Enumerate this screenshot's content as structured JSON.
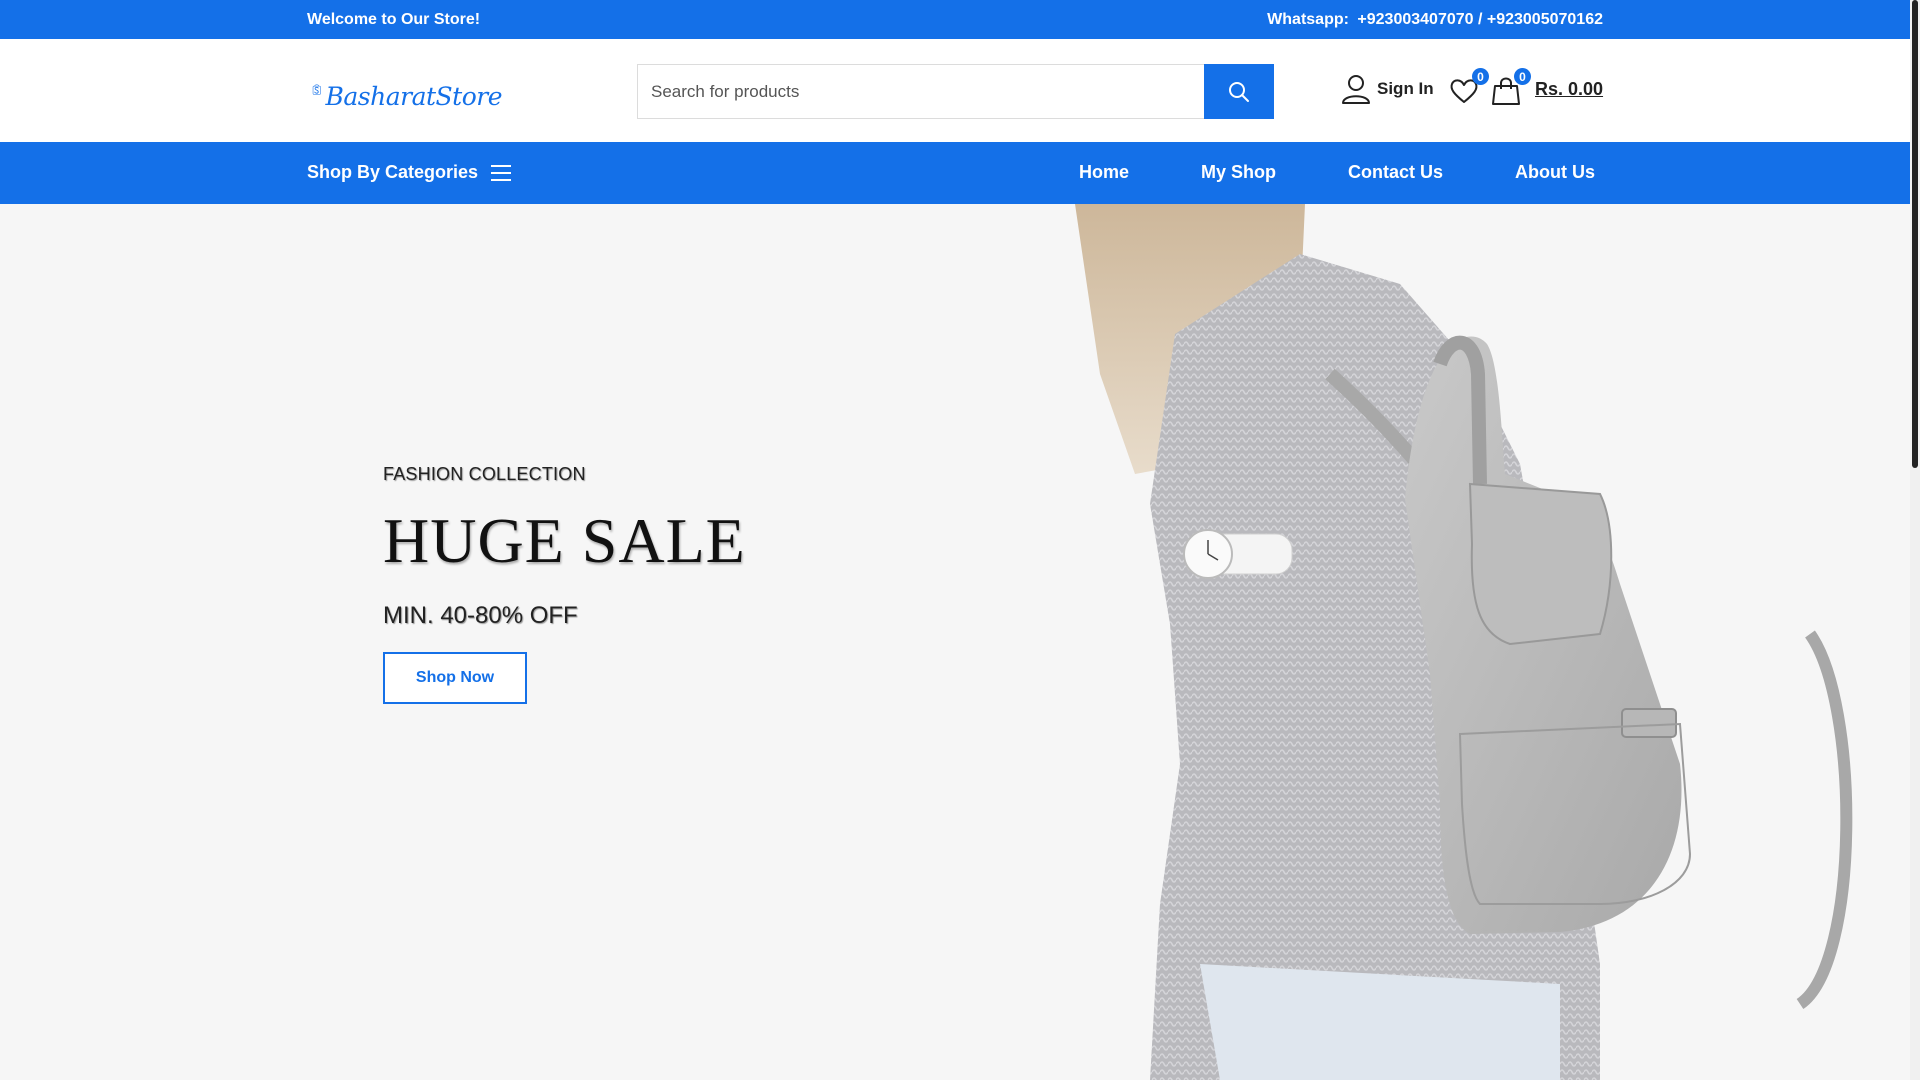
{
  "topbar": {
    "welcome": "Welcome to Our Store!",
    "whatsapp_label": "Whatsapp:",
    "phones": "+923003407070 /  +923005070162"
  },
  "header": {
    "logo_text": "BasharatStore",
    "search_placeholder": "Search for products",
    "signin_label": "Sign In",
    "wishlist_count": "0",
    "cart_count": "0",
    "cart_total": "Rs. 0.00"
  },
  "nav": {
    "categories_label": "Shop By Categories",
    "links": [
      "Home",
      "My Shop",
      "Contact Us",
      "About Us"
    ]
  },
  "hero": {
    "subtitle": "FASHION COLLECTION",
    "title": "HUGE SALE",
    "offer": "MIN. 40-80% OFF",
    "cta": "Shop Now"
  },
  "colors": {
    "brand": "#1470e8",
    "background": "#f6f6f6"
  },
  "icons": [
    "search-icon",
    "user-icon",
    "heart-icon",
    "bag-icon",
    "menu-icon"
  ]
}
